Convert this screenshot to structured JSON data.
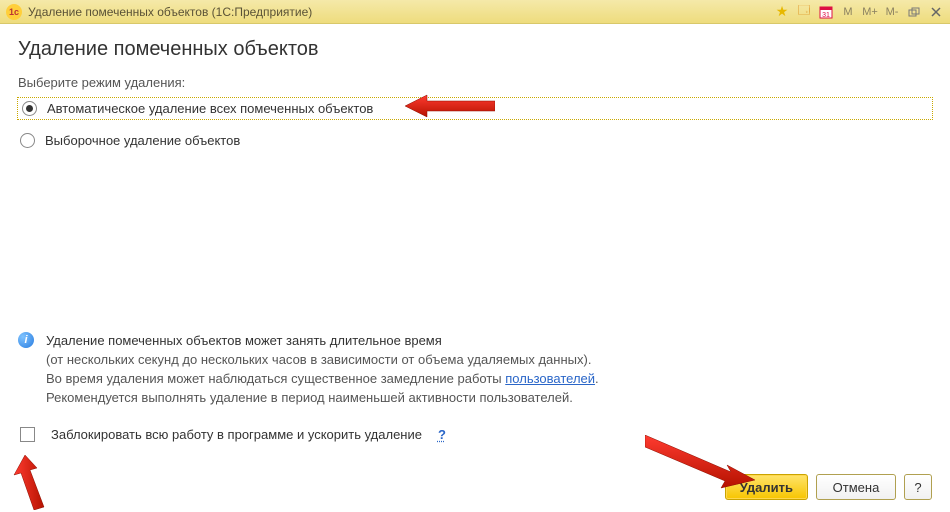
{
  "titlebar": {
    "title": "Удаление помеченных объектов  (1С:Предприятие)",
    "logo_text": "1c",
    "buttons": {
      "m": "M",
      "m_plus": "M+",
      "m_minus": "M-"
    }
  },
  "page": {
    "heading": "Удаление помеченных объектов",
    "prompt": "Выберите режим удаления:"
  },
  "modes": {
    "auto": "Автоматическое удаление всех помеченных объектов",
    "selective": "Выборочное удаление объектов"
  },
  "info": {
    "line1": "Удаление помеченных объектов может занять длительное время",
    "line2_a": "(от нескольких секунд до нескольких часов в зависимости от объема удаляемых данных).",
    "line3_a": "Во время удаления может наблюдаться существенное замедление работы ",
    "line3_link": "пользователей",
    "line3_b": ".",
    "line4": "Рекомендуется выполнять удаление в период наименьшей активности пользователей."
  },
  "block": {
    "label": "Заблокировать всю работу в программе и ускорить удаление",
    "help": "?"
  },
  "footer": {
    "delete": "Удалить",
    "cancel": "Отмена",
    "help": "?"
  }
}
